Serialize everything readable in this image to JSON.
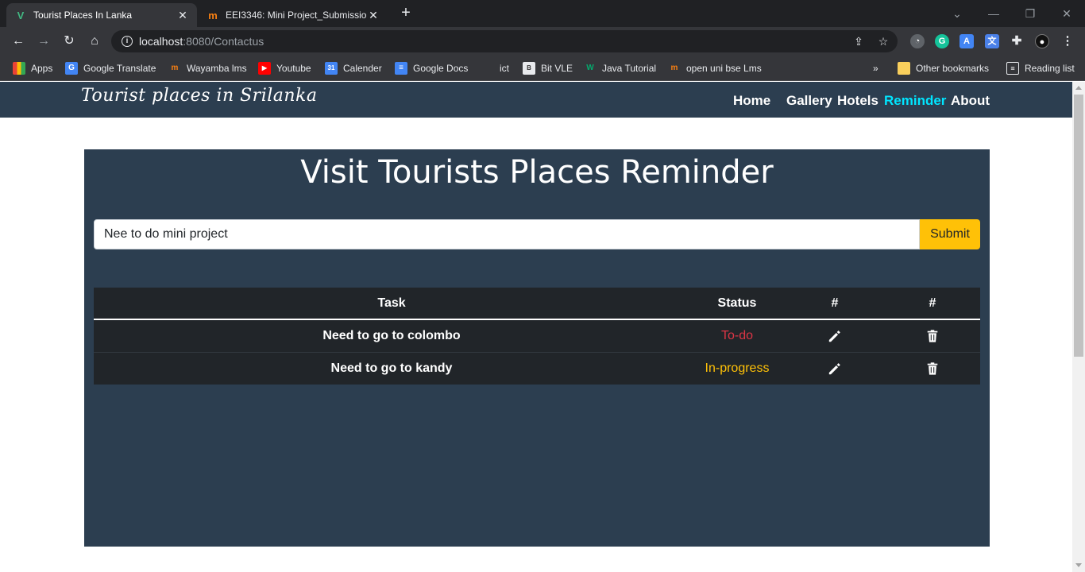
{
  "browser": {
    "tabs": [
      {
        "title": "Tourist Places In Lanka",
        "active": true,
        "favicon": "vue-icon"
      },
      {
        "title": "EEI3346: Mini Project_Submission",
        "active": false,
        "favicon": "moodle-icon"
      }
    ],
    "url_host": "localhost",
    "url_path": ":8080/Contactus",
    "bookmarks": [
      {
        "label": "Apps",
        "icon": "apps-grid-icon"
      },
      {
        "label": "Google Translate",
        "icon": "translate-icon"
      },
      {
        "label": "Wayamba lms",
        "icon": "moodle-icon"
      },
      {
        "label": "Youtube",
        "icon": "youtube-icon"
      },
      {
        "label": "Calender",
        "icon": "calendar-icon"
      },
      {
        "label": "Google Docs",
        "icon": "docs-icon"
      },
      {
        "label": "ict",
        "icon": ""
      },
      {
        "label": "Bit VLE",
        "icon": "bit-icon"
      },
      {
        "label": "Java Tutorial",
        "icon": "w3-icon"
      },
      {
        "label": "open uni bse Lms",
        "icon": "moodle-icon"
      }
    ],
    "other_bookmarks": "Other bookmarks",
    "reading_list": "Reading list",
    "overflow": "»"
  },
  "site": {
    "brand": "Tourist places in Srilanka",
    "nav": [
      "Home",
      "Gallery",
      "Hotels",
      "Reminder",
      "About"
    ],
    "active_nav": "Reminder"
  },
  "reminder": {
    "heading": "Visit Tourists Places Reminder",
    "input_value": "Nee to do mini project",
    "submit_label": "Submit",
    "columns": [
      "Task",
      "Status",
      "#",
      "#"
    ],
    "rows": [
      {
        "task": "Need to go to colombo",
        "status": "To-do"
      },
      {
        "task": "Need to go to kandy",
        "status": "In-progress"
      }
    ]
  },
  "colors": {
    "nav_bg": "#2c3e50",
    "active_link": "#00e5ff",
    "todo": "#dc3545",
    "in_progress": "#ffc107",
    "submit": "#ffc107"
  }
}
